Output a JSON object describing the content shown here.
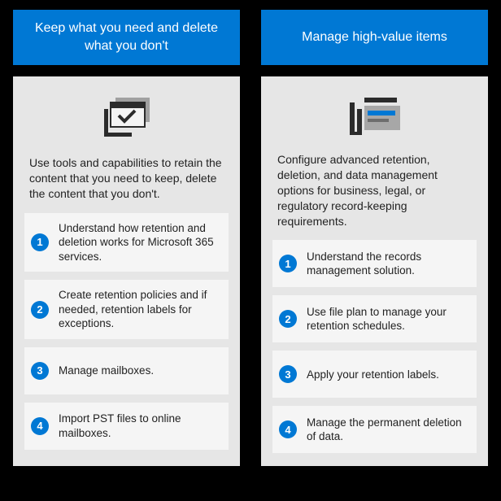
{
  "colors": {
    "accent": "#0078D4",
    "panel": "#E6E6E6",
    "card": "#F5F5F5"
  },
  "columns": [
    {
      "key": "keep",
      "header": "Keep what you need and delete what you don't",
      "icon": "check-window-icon",
      "desc": "Use tools and capabilities to retain the content that you need to keep, delete the content that you don't.",
      "steps": [
        {
          "n": "1",
          "text": "Understand how retention and deletion works for Microsoft 365 services."
        },
        {
          "n": "2",
          "text": "Create retention policies and if needed, retention labels for exceptions."
        },
        {
          "n": "3",
          "text": "Manage mailboxes."
        },
        {
          "n": "4",
          "text": "Import PST files to online mailboxes."
        }
      ]
    },
    {
      "key": "manage",
      "header": "Manage high-value items",
      "icon": "records-list-icon",
      "desc": "Configure advanced retention, deletion, and data management options for business, legal, or regulatory record-keeping requirements.",
      "steps": [
        {
          "n": "1",
          "text": "Understand the records management solution."
        },
        {
          "n": "2",
          "text": "Use file plan to manage your retention schedules."
        },
        {
          "n": "3",
          "text": "Apply your retention labels."
        },
        {
          "n": "4",
          "text": "Manage the permanent deletion of data."
        }
      ]
    }
  ]
}
